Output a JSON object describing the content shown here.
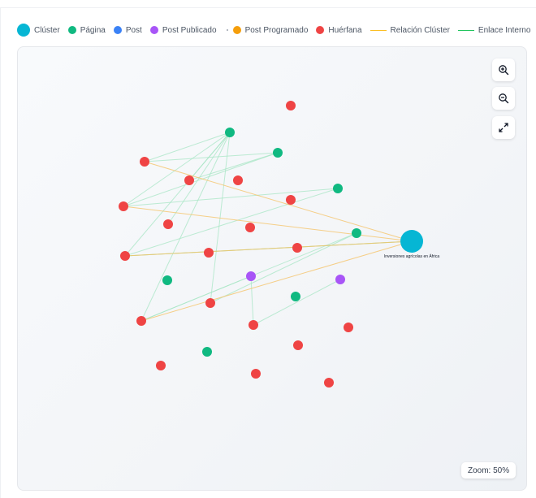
{
  "legend": [
    {
      "label": "Clúster",
      "kind": "big",
      "color": "#06b6d4"
    },
    {
      "label": "Página",
      "kind": "dot",
      "color": "#10b981"
    },
    {
      "label": "Post",
      "kind": "dot",
      "color": "#3b82f6"
    },
    {
      "label": "Post Publicado",
      "kind": "dot",
      "color": "#a855f7"
    },
    {
      "label": "Post Programado",
      "kind": "dot",
      "color": "#f59e0b",
      "prefix_dot": true
    },
    {
      "label": "Huérfana",
      "kind": "dot",
      "color": "#ef4444"
    },
    {
      "label": "Relación Clúster",
      "kind": "line",
      "color": "#fbbf24"
    },
    {
      "label": "Enlace Interno",
      "kind": "line",
      "color": "#22c55e"
    }
  ],
  "colors": {
    "cluster": "#06b6d4",
    "pagina": "#10b981",
    "publicado": "#a855f7",
    "huerfana": "#ef4444",
    "cluster_edge": "#f5c46a",
    "internal_edge": "#a7e6c4"
  },
  "graph": {
    "cluster_label": "Inversiones agrícolas en África"
  },
  "controls": {
    "zoom_in": "zoom-in",
    "zoom_out": "zoom-out",
    "fullscreen": "fullscreen"
  },
  "zoom": {
    "text": "Zoom: 50%"
  }
}
